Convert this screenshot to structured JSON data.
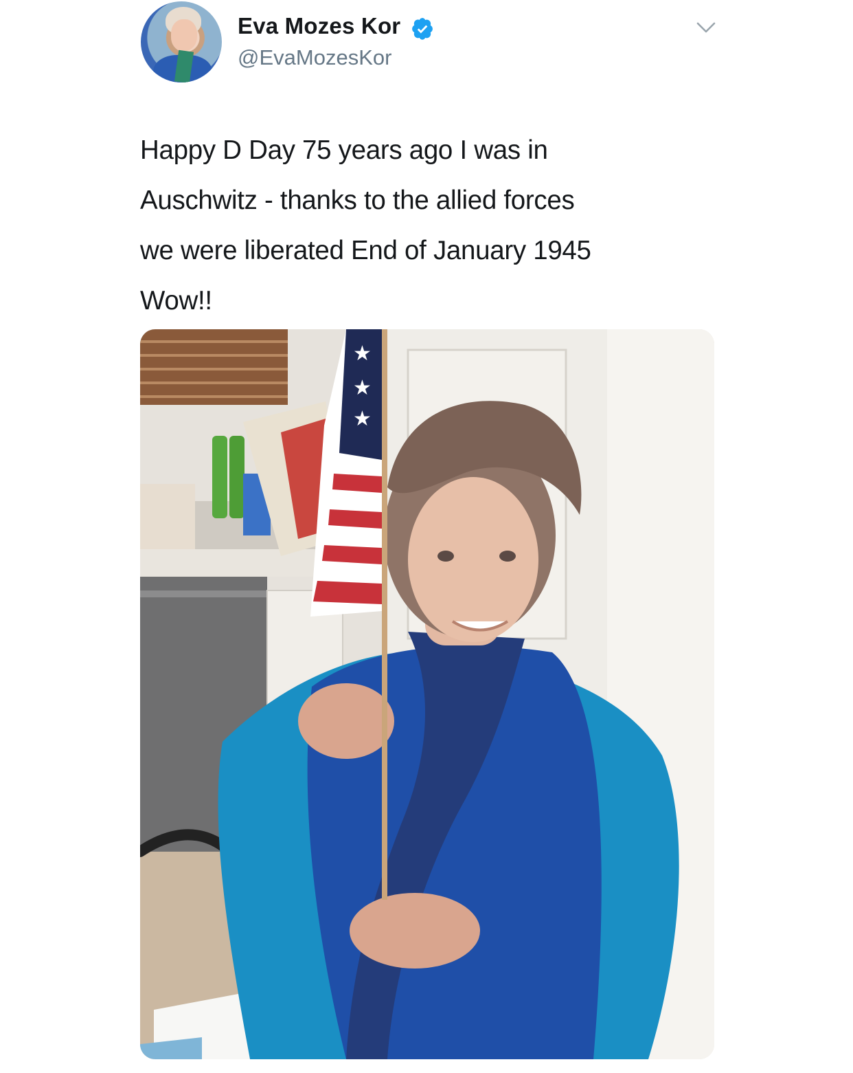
{
  "tweet": {
    "author": {
      "display_name": "Eva Mozes Kor",
      "handle": "@EvaMozesKor",
      "verified": true,
      "verified_color": "#1da1f2"
    },
    "menu_icon": "chevron-down-icon",
    "text_lines": [
      "Happy D Day 75 years ago I was in",
      "Auschwitz - thanks to the allied forces",
      "we were liberated End of January 1945",
      "Wow!!"
    ],
    "media": {
      "type": "photo",
      "colors": {
        "cardigan": "#1f4fa8",
        "blouse": "#1a8fc4",
        "flag_red": "#c8323a",
        "flag_blue": "#1f2a55"
      }
    }
  }
}
